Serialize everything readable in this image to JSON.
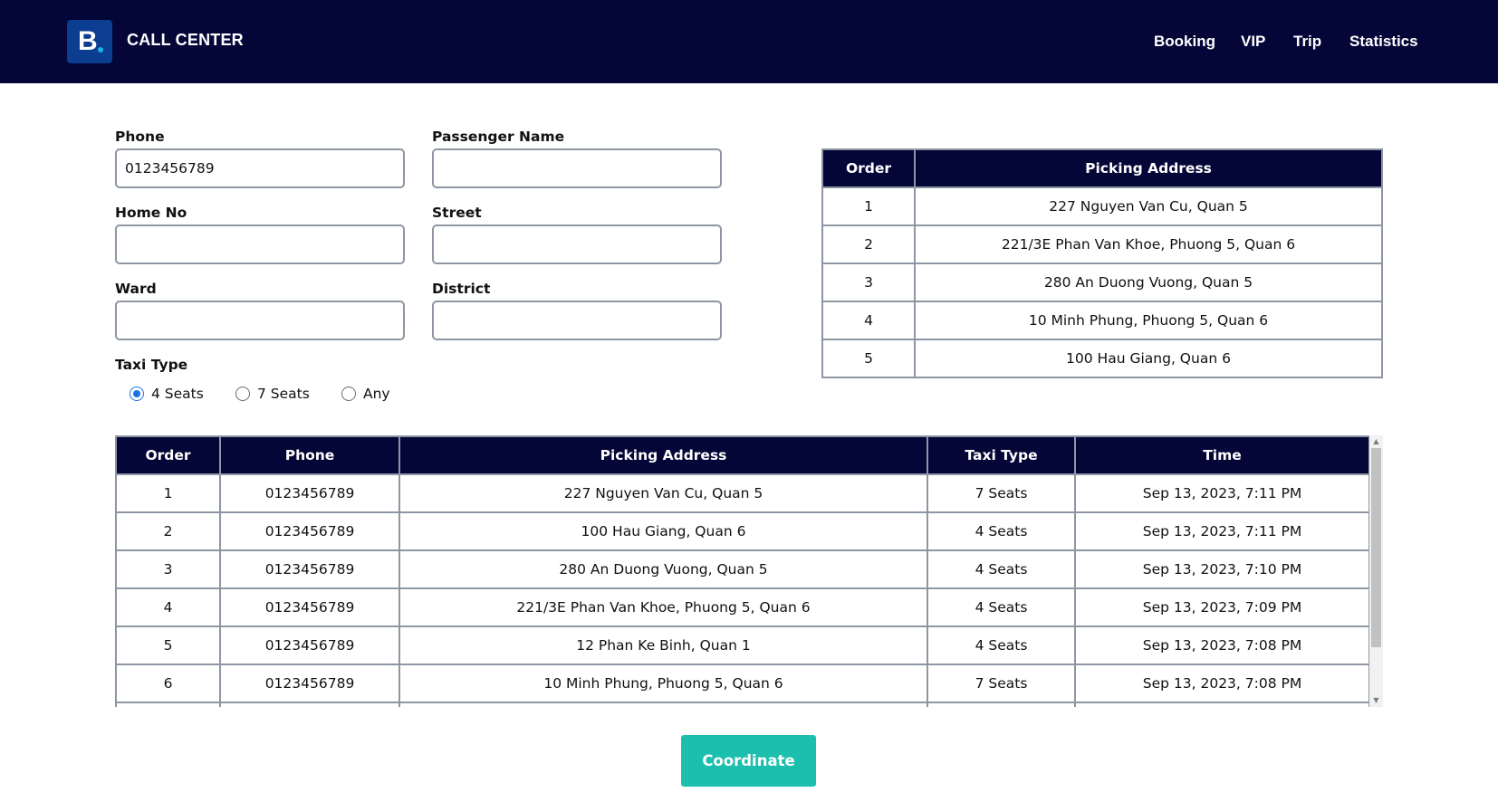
{
  "header": {
    "logo_letter": "B",
    "brand": "CALL CENTER",
    "nav": [
      "Booking",
      "VIP",
      "Trip",
      "Statistics"
    ]
  },
  "form": {
    "phone": {
      "label": "Phone",
      "value": "0123456789"
    },
    "passenger_name": {
      "label": "Passenger Name",
      "value": ""
    },
    "home_no": {
      "label": "Home No",
      "value": ""
    },
    "street": {
      "label": "Street",
      "value": ""
    },
    "ward": {
      "label": "Ward",
      "value": ""
    },
    "district": {
      "label": "District",
      "value": ""
    },
    "taxi_type": {
      "label": "Taxi Type",
      "options": [
        "4 Seats",
        "7 Seats",
        "Any"
      ],
      "selected": "4 Seats"
    }
  },
  "address_table": {
    "headers": [
      "Order",
      "Picking Address"
    ],
    "rows": [
      [
        "1",
        "227 Nguyen Van Cu, Quan 5"
      ],
      [
        "2",
        "221/3E Phan Van Khoe, Phuong 5, Quan 6"
      ],
      [
        "3",
        "280 An Duong Vuong, Quan 5"
      ],
      [
        "4",
        "10 Minh Phung, Phuong 5, Quan 6"
      ],
      [
        "5",
        "100 Hau Giang, Quan 6"
      ]
    ]
  },
  "booking_table": {
    "headers": [
      "Order",
      "Phone",
      "Picking Address",
      "Taxi Type",
      "Time"
    ],
    "rows": [
      [
        "1",
        "0123456789",
        "227 Nguyen Van Cu, Quan 5",
        "7 Seats",
        "Sep 13, 2023, 7:11 PM"
      ],
      [
        "2",
        "0123456789",
        "100 Hau Giang, Quan 6",
        "4 Seats",
        "Sep 13, 2023, 7:11 PM"
      ],
      [
        "3",
        "0123456789",
        "280 An Duong Vuong, Quan 5",
        "4 Seats",
        "Sep 13, 2023, 7:10 PM"
      ],
      [
        "4",
        "0123456789",
        "221/3E Phan Van Khoe, Phuong 5, Quan 6",
        "4 Seats",
        "Sep 13, 2023, 7:09 PM"
      ],
      [
        "5",
        "0123456789",
        "12 Phan Ke Binh, Quan 1",
        "4 Seats",
        "Sep 13, 2023, 7:08 PM"
      ],
      [
        "6",
        "0123456789",
        "10 Minh Phung, Phuong 5, Quan 6",
        "7 Seats",
        "Sep 13, 2023, 7:08 PM"
      ],
      [
        "",
        "",
        "",
        "",
        ""
      ]
    ]
  },
  "coordinate_button": "Coordinate",
  "colors": {
    "header_bg": "#030637",
    "logo_bg": "#0b3d91",
    "logo_dot": "#18b4e9",
    "button": "#1cbfae",
    "radio_selected": "#1a73e8",
    "border": "#8f96a3"
  }
}
